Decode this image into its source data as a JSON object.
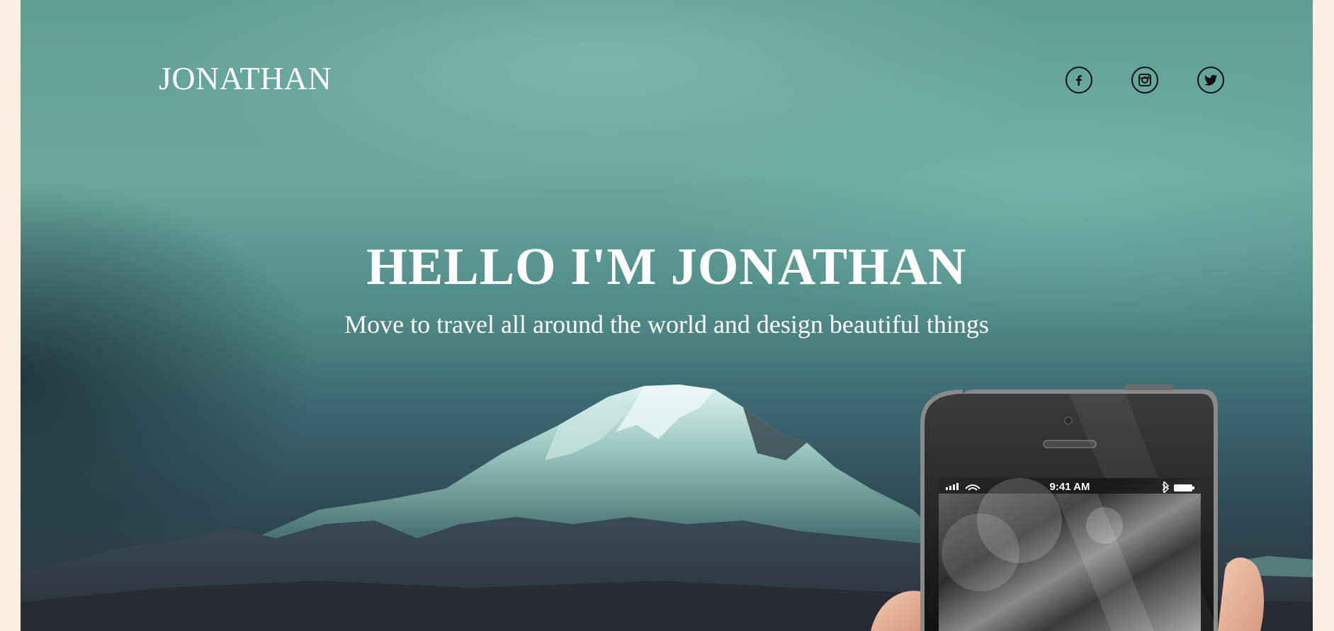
{
  "header": {
    "logo": "JONATHAN",
    "social": [
      {
        "name": "facebook",
        "icon": "facebook-icon"
      },
      {
        "name": "instagram",
        "icon": "instagram-icon"
      },
      {
        "name": "twitter",
        "icon": "twitter-icon"
      }
    ]
  },
  "hero": {
    "headline": "HELLO I'M JONATHAN",
    "subheadline": "Move to travel all around the world and design beautiful things"
  },
  "phone": {
    "status_time": "9:41 AM"
  },
  "colors": {
    "page_background": "#fcefe1",
    "hero_teal": "#6aa89f",
    "text": "#ffffff",
    "icon_stroke": "#111111"
  }
}
